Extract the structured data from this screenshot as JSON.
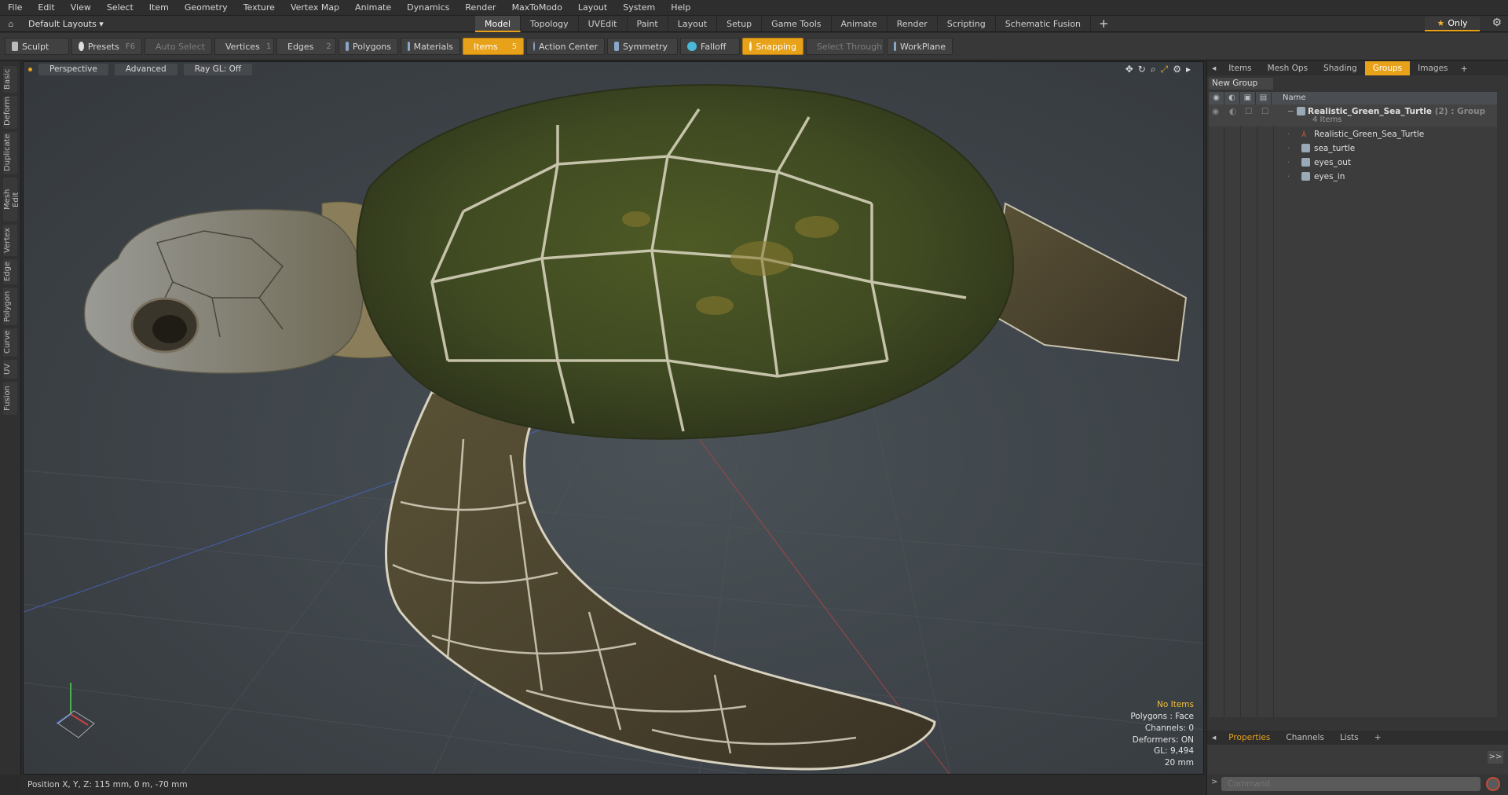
{
  "menu": [
    "File",
    "Edit",
    "View",
    "Select",
    "Item",
    "Geometry",
    "Texture",
    "Vertex Map",
    "Animate",
    "Dynamics",
    "Render",
    "MaxToModo",
    "Layout",
    "System",
    "Help"
  ],
  "layout": {
    "selector": "Default Layouts ▾",
    "tabs": [
      "Model",
      "Topology",
      "UVEdit",
      "Paint",
      "Layout",
      "Setup",
      "Game Tools",
      "Animate",
      "Render",
      "Scripting",
      "Schematic Fusion"
    ],
    "active_tab": "Model",
    "plus": "+",
    "only_label": "Only"
  },
  "toolbar": {
    "sculpt": "Sculpt",
    "presets": "Presets",
    "presets_key": "F6",
    "auto_select": "Auto Select",
    "vertices": "Vertices",
    "vertices_key": "1",
    "edges": "Edges",
    "edges_key": "2",
    "polygons": "Polygons",
    "materials": "Materials",
    "items": "Items",
    "items_key": "5",
    "action_center": "Action Center",
    "symmetry": "Symmetry",
    "falloff": "Falloff",
    "snapping": "Snapping",
    "select_through": "Select Through",
    "workplane": "WorkPlane"
  },
  "left_tabs": [
    "Basic",
    "Deform",
    "Duplicate",
    "Mesh Edit",
    "Vertex",
    "Edge",
    "Polygon",
    "Curve",
    "UV",
    "Fusion"
  ],
  "viewport": {
    "view_mode": "Perspective",
    "shading": "Advanced",
    "raygl": "Ray GL: Off",
    "stats": {
      "items": "No Items",
      "polygons": "Polygons : Face",
      "channels": "Channels: 0",
      "deformers": "Deformers: ON",
      "gl": "GL: 9,494",
      "scale": "20 mm"
    }
  },
  "status_bar": {
    "position": "Position X, Y, Z:   115 mm, 0 m, -70 mm"
  },
  "right_panel": {
    "tabs": [
      "Items",
      "Mesh Ops",
      "Shading",
      "Groups",
      "Images"
    ],
    "active_tab": "Groups",
    "plus": "+",
    "new_group": "New Group",
    "column_name": "Name",
    "group": {
      "name": "Realistic_Green_Sea_Turtle",
      "meta": "(2) : Group",
      "count": "4 Items"
    },
    "children": [
      "Realistic_Green_Sea_Turtle",
      "sea_turtle",
      "eyes_out",
      "eyes_in"
    ],
    "bottom_tabs": [
      "Properties",
      "Channels",
      "Lists"
    ],
    "bottom_active": "Properties",
    "expand": ">>",
    "command_placeholder": "Command"
  },
  "colors": {
    "accent": "#e8a21a",
    "panel": "#353535",
    "viewport_bg": "#3d4348"
  }
}
